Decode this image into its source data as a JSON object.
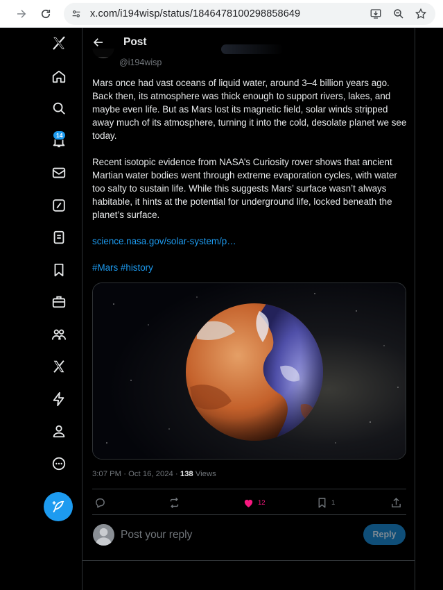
{
  "browser": {
    "url": "x.com/i194wisp/status/1846478100298858649"
  },
  "sidebar": {
    "notifications_badge": "14"
  },
  "header": {
    "title": "Post"
  },
  "tweet": {
    "handle": "@i194wisp",
    "paragraph1": "Mars once had vast oceans of liquid water, around 3–4 billion years ago. Back then, its atmosphere was thick enough to support rivers, lakes, and maybe even life. But as Mars lost its magnetic field, solar winds stripped away much of its atmosphere, turning it into the cold, desolate planet we see today.",
    "paragraph2": "Recent isotopic evidence from NASA’s Curiosity rover shows that ancient Martian water bodies went through extreme evaporation cycles, with water too salty to sustain life. While this suggests Mars’ surface wasn’t always habitable, it hints at the potential for underground life, locked beneath the planet’s surface.",
    "link": "science.nasa.gov/solar-system/p…",
    "hashtags": "#Mars #history",
    "time": "3:07 PM · Oct 16, 2024 · ",
    "views_count": "138",
    "views_label": " Views",
    "likes": "12",
    "bookmarks": "1"
  },
  "reply": {
    "placeholder": "Post your reply",
    "button_label": "Reply"
  },
  "colors": {
    "accent": "#1d9bf0",
    "like": "#f91880",
    "background": "#000000",
    "muted": "#71767b"
  },
  "icons": [
    "x-logo-icon",
    "home-icon",
    "search-icon",
    "bell-icon",
    "mail-icon",
    "grok-icon",
    "lists-icon",
    "bookmark-icon",
    "jobs-icon",
    "communities-icon",
    "premium-icon",
    "verified-orgs-icon",
    "profile-icon",
    "more-icon",
    "compose-icon"
  ]
}
